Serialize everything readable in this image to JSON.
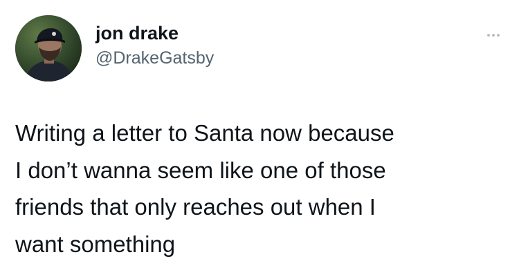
{
  "tweet": {
    "author": {
      "display_name": "jon drake",
      "handle": "@DrakeGatsby",
      "avatar_icon": "profile-photo"
    },
    "more_icon": "more-horizontal-icon",
    "text_lines": [
      "Writing a letter to Santa now because",
      "I don’t wanna seem like one of those",
      "friends that only reaches out when I",
      "want something"
    ]
  },
  "colors": {
    "background": "#ffffff",
    "text": "#0f1419",
    "secondary_text": "#536471"
  }
}
